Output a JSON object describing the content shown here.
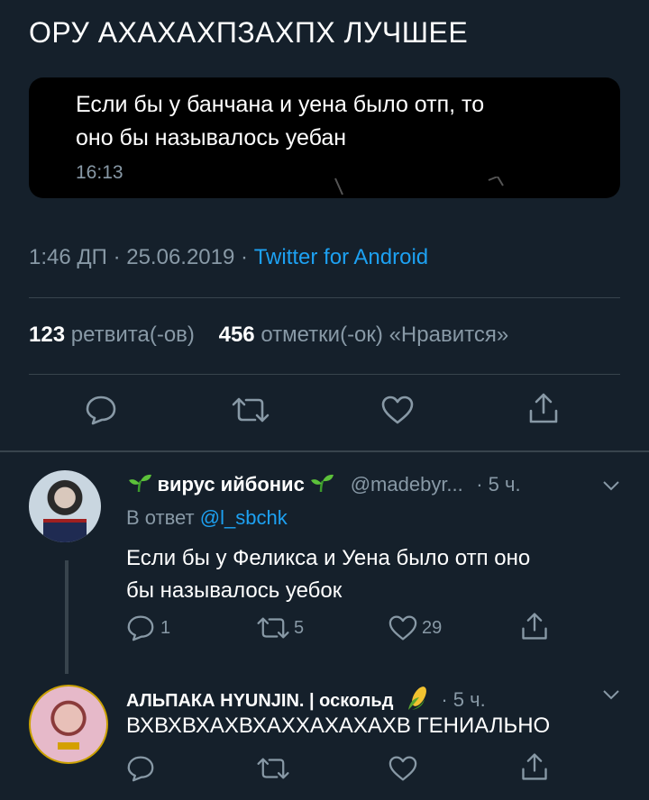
{
  "tweet": {
    "text": "ОРУ АХАХАХПЗАХПХ ЛУЧШЕЕ",
    "quoted": {
      "line1": "Если бы у банчана и уена было отп, то",
      "line2": "оно бы называлось уебан",
      "time": "16:13"
    },
    "time": "1:46 ДП",
    "date": "25.06.2019",
    "client": "Twitter for Android",
    "retweets": "123",
    "retweets_label": "ретвита(-ов)",
    "likes": "456",
    "likes_label": "отметки(-ок) «Нравится»"
  },
  "replies": [
    {
      "name": "вирус ийбонис",
      "handle": "@madebyr...",
      "time": "· 5 ч.",
      "reply_to_label": "В ответ",
      "reply_to": "@l_sbchk",
      "text_line1": "Если бы у Феликса и Уена было отп оно",
      "text_line2": "бы называлось уебок",
      "replies_count": "1",
      "retweets_count": "5",
      "likes_count": "29",
      "emoji_icon": "seedling-icon"
    },
    {
      "name": "АЛЬПАКА HYUNJIN. | оскольд",
      "time": "· 5 ч.",
      "text": "ВХВХВХАХВХАХХАХАХАХВ ГЕНИАЛЬНО",
      "emoji_icon": "corn-icon"
    }
  ],
  "colors": {
    "background": "#15202b",
    "accent": "#1da1f2",
    "muted": "#8899a6",
    "divider": "#38444d"
  }
}
